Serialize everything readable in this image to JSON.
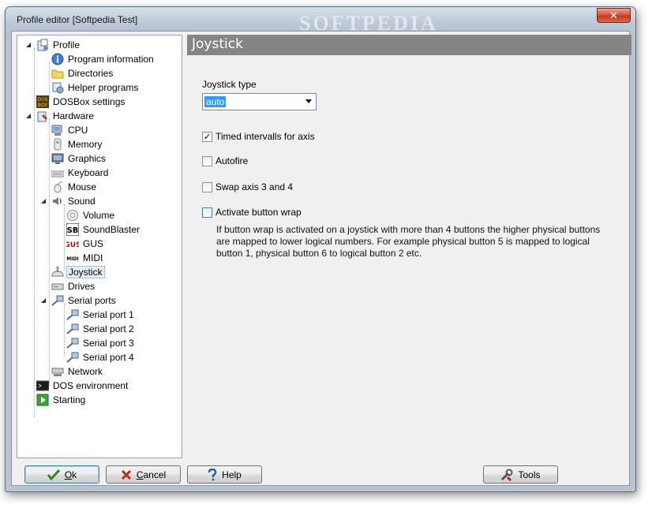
{
  "window": {
    "title": "Profile editor [Softpedia Test]",
    "watermark": "SOFTPEDIA",
    "close_label": "✕"
  },
  "tree": {
    "items": [
      {
        "label": "Profile",
        "icon": "profile-icon"
      },
      {
        "label": "Program information",
        "icon": "info-icon"
      },
      {
        "label": "Directories",
        "icon": "folder-icon"
      },
      {
        "label": "Helper programs",
        "icon": "helper-programs-icon"
      },
      {
        "label": "DOSBox settings",
        "icon": "dosbox-icon"
      },
      {
        "label": "Hardware",
        "icon": "hardware-icon"
      },
      {
        "label": "CPU",
        "icon": "cpu-icon"
      },
      {
        "label": "Memory",
        "icon": "memory-icon"
      },
      {
        "label": "Graphics",
        "icon": "graphics-icon"
      },
      {
        "label": "Keyboard",
        "icon": "keyboard-icon"
      },
      {
        "label": "Mouse",
        "icon": "mouse-icon"
      },
      {
        "label": "Sound",
        "icon": "sound-icon"
      },
      {
        "label": "Volume",
        "icon": "volume-icon"
      },
      {
        "label": "SoundBlaster",
        "icon": "soundblaster-icon"
      },
      {
        "label": "GUS",
        "icon": "gus-icon"
      },
      {
        "label": "MIDI",
        "icon": "midi-icon"
      },
      {
        "label": "Joystick",
        "icon": "joystick-icon"
      },
      {
        "label": "Drives",
        "icon": "drives-icon"
      },
      {
        "label": "Serial ports",
        "icon": "serial-ports-icon"
      },
      {
        "label": "Serial port 1",
        "icon": "serial-port-icon"
      },
      {
        "label": "Serial port 2",
        "icon": "serial-port-icon"
      },
      {
        "label": "Serial port 3",
        "icon": "serial-port-icon"
      },
      {
        "label": "Serial port 4",
        "icon": "serial-port-icon"
      },
      {
        "label": "Network",
        "icon": "network-icon"
      },
      {
        "label": "DOS environment",
        "icon": "dos-environment-icon"
      },
      {
        "label": "Starting",
        "icon": "starting-icon"
      }
    ],
    "icon_text": {
      "dosbox": "DOS BOX",
      "soundblaster": "SB",
      "gus": "GUS",
      "midi": "MIDI"
    },
    "selected": "Joystick"
  },
  "panel": {
    "title": "Joystick",
    "joystick_type_label": "Joystick type",
    "joystick_type_value": "auto",
    "timed_intervals_label": "Timed intervalls for axis",
    "timed_intervals_checked": true,
    "autofire_label": "Autofire",
    "autofire_checked": false,
    "swap_axis_label": "Swap axis 3 and 4",
    "swap_axis_checked": false,
    "button_wrap_label": "Activate button wrap",
    "button_wrap_checked": false,
    "check_mark": "✓",
    "description": "If button wrap is activated on a joystick with more than 4 buttons the higher physical buttons are mapped to lower logical numbers. For example physical button 5 is mapped to logical button 1, physical button 6 to logical button 2 etc."
  },
  "buttons": {
    "ok_accel": "O",
    "ok_rest": "k",
    "cancel_accel": "C",
    "cancel_rest": "ancel",
    "help": "Help",
    "tools": "Tools"
  },
  "colors": {
    "accent_selection": "#3399ff",
    "panel_header": "#858585",
    "ok_icon": "#2c8a1f",
    "cancel_icon": "#c0281c"
  }
}
